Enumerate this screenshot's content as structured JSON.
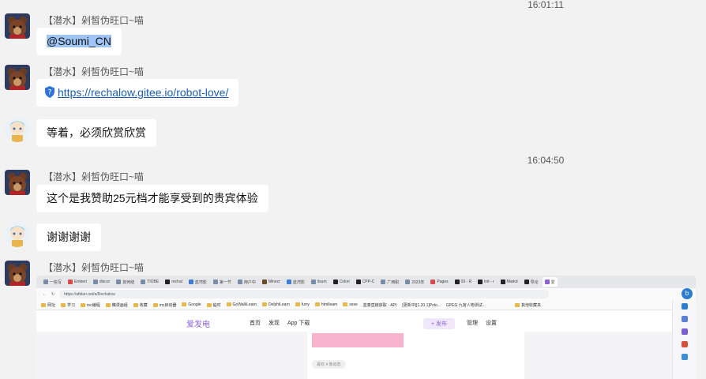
{
  "timestamps": [
    "16:01:11",
    "16:04:50"
  ],
  "messages": [
    {
      "sender": "【潜水】剁皙伪旺口~喵",
      "text": "@Soumi_CN"
    },
    {
      "sender": "【潜水】剁皙伪旺口~喵",
      "text": "https://rechalow.gitee.io/robot-love/"
    },
    {
      "sender": "",
      "text": "等着，必须欣赏欣赏"
    },
    {
      "sender": "【潜水】剁皙伪旺口~喵",
      "text": "这个是我赞助25元档才能享受到的贵宾体验"
    },
    {
      "sender": "",
      "text": "谢谢谢谢"
    },
    {
      "sender": "【潜水】剁皙伪旺口~喵",
      "text": ""
    }
  ],
  "screenshot": {
    "tabs": [
      "一些写",
      "Emberi",
      "discor",
      "如何结",
      "TIOBE",
      "rechal",
      "蓝湾影",
      "第一节",
      "用户中",
      "Minecr",
      "蓝湾影",
      "ilsum",
      "Colori",
      "CPP-C",
      "广西职",
      "2023年",
      "Pages",
      "03 - R",
      "init - r",
      "Markd",
      "导论",
      "爱"
    ],
    "url": "https://afdian.net/a/Rechalow",
    "bookmarks": [
      "网址",
      "学习",
      "mc编程",
      "藕漫画组",
      "收藏",
      "mc启动器",
      "Google",
      "临时",
      "GoWalkLearn",
      "DelphiLearn",
      "furry",
      "htmlleam",
      "sese",
      "蓝奏直链获取 - API",
      "[更新中][1.20.1]Polo...",
      "GPEG 九宫人物测试...",
      "其他收藏夹"
    ],
    "site_logo": "爱发电",
    "site_nav": [
      "首页",
      "发现",
      "App 下载"
    ],
    "publish": "+ 发布",
    "site_right": [
      "管理",
      "设置"
    ],
    "likes_label": "喜欢 4 条动态"
  }
}
